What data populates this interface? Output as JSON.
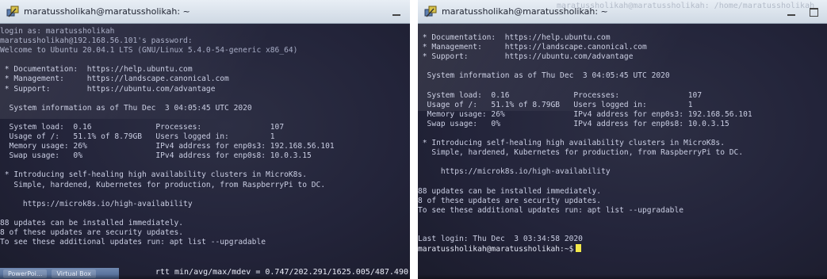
{
  "left": {
    "window_title": "maratussholikah@maratussholikah: ~",
    "ghost_title": "",
    "lines": [
      "login as: maratussholikah",
      "maratussholikah@192.168.56.101's password:",
      "Welcome to Ubuntu 20.04.1 LTS (GNU/Linux 5.4.0-54-generic x86_64)",
      "",
      " * Documentation:  https://help.ubuntu.com",
      " * Management:     https://landscape.canonical.com",
      " * Support:        https://ubuntu.com/advantage",
      "",
      "  System information as of Thu Dec  3 04:05:45 UTC 2020",
      "",
      "  System load:  0.16              Processes:               107",
      "  Usage of /:   51.1% of 8.79GB   Users logged in:         1",
      "  Memory usage: 26%               IPv4 address for enp0s3: 192.168.56.101",
      "  Swap usage:   0%                IPv4 address for enp0s8: 10.0.3.15",
      "",
      " * Introducing self-healing high availability clusters in MicroK8s.",
      "   Simple, hardened, Kubernetes for production, from RaspberryPi to DC.",
      "",
      "     https://microk8s.io/high-availability",
      "",
      "88 updates can be installed immediately.",
      "8 of these updates are security updates.",
      "To see these additional updates run: apt list --upgradable"
    ],
    "rtt_text": "rtt min/avg/max/mdev = 0.747/202.291/1625.005/487.490",
    "taskbar_items": [
      "PowerPoi...",
      "Virtual Box"
    ]
  },
  "right": {
    "window_title": "maratussholikah@maratussholikah: ~",
    "ghost_title": "maratussholikah@maratussholikah: /home/maratussholikah",
    "lines": [
      " * Documentation:  https://help.ubuntu.com",
      " * Management:     https://landscape.canonical.com",
      " * Support:        https://ubuntu.com/advantage",
      "",
      "  System information as of Thu Dec  3 04:05:45 UTC 2020",
      "",
      "  System load:  0.16              Processes:               107",
      "  Usage of /:   51.1% of 8.79GB   Users logged in:         1",
      "  Memory usage: 26%               IPv4 address for enp0s3: 192.168.56.101",
      "  Swap usage:   0%                IPv4 address for enp0s8: 10.0.3.15",
      "",
      " * Introducing self-healing high availability clusters in MicroK8s.",
      "   Simple, hardened, Kubernetes for production, from RaspberryPi to DC.",
      "",
      "     https://microk8s.io/high-availability",
      "",
      "88 updates can be installed immediately.",
      "8 of these updates are security updates.",
      "To see these additional updates run: apt list --upgradable",
      "",
      "",
      "Last login: Thu Dec  3 03:34:58 2020"
    ],
    "prompt": "maratussholikah@maratussholikah:~$"
  },
  "colors": {
    "terminal_bg": "#23243a",
    "terminal_text": "#c9cde2",
    "cursor": "#f2e84a",
    "titlebar": "#dfe6ef"
  },
  "icons": [
    "putty-icon",
    "minimize-icon",
    "maximize-icon"
  ]
}
